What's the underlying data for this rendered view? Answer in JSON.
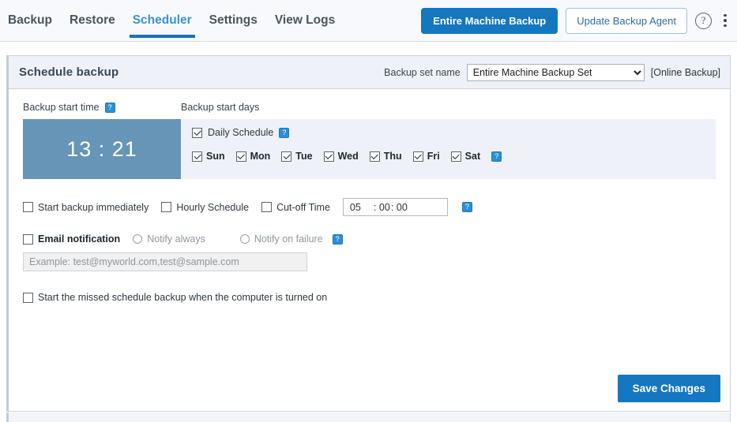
{
  "nav": {
    "items": [
      {
        "label": "Backup",
        "active": false
      },
      {
        "label": "Restore",
        "active": false
      },
      {
        "label": "Scheduler",
        "active": true
      },
      {
        "label": "Settings",
        "active": false
      },
      {
        "label": "View Logs",
        "active": false
      }
    ]
  },
  "top_actions": {
    "primary_button": "Entire Machine Backup",
    "secondary_button": "Update Backup Agent",
    "help_icon": "question-mark-circle-icon",
    "menu_icon": "kebab-menu-icon"
  },
  "panel": {
    "title": "Schedule backup",
    "backup_set_label": "Backup set name",
    "backup_set_value": "Entire Machine Backup Set",
    "backup_set_options": [
      "Entire Machine Backup Set"
    ],
    "online_tag": "[Online Backup]"
  },
  "start_time": {
    "label": "Backup start time",
    "help_icon": "help-icon",
    "value": "13 : 21",
    "hours": "13",
    "minutes": "21"
  },
  "start_days": {
    "label": "Backup start days",
    "daily_schedule": {
      "label": "Daily Schedule",
      "checked": true,
      "help_icon": "help-icon"
    },
    "days": [
      {
        "label": "Sun",
        "checked": true
      },
      {
        "label": "Mon",
        "checked": true
      },
      {
        "label": "Tue",
        "checked": true
      },
      {
        "label": "Wed",
        "checked": true
      },
      {
        "label": "Thu",
        "checked": true
      },
      {
        "label": "Fri",
        "checked": true
      },
      {
        "label": "Sat",
        "checked": true
      }
    ],
    "days_help_icon": "help-icon"
  },
  "options": {
    "start_immediately": {
      "label": "Start backup immediately",
      "checked": false
    },
    "hourly_schedule": {
      "label": "Hourly Schedule",
      "checked": false
    },
    "cutoff_time": {
      "label": "Cut-off Time",
      "checked": false
    },
    "cutoff_value": {
      "hours": "05",
      "minutes": ": 00",
      "seconds": ": 00"
    },
    "cutoff_help_icon": "help-icon"
  },
  "email": {
    "notification": {
      "label": "Email notification",
      "checked": false
    },
    "notify_always": {
      "label": "Notify always",
      "selected": false
    },
    "notify_on_failure": {
      "label": "Notify on failure",
      "selected": false
    },
    "help_icon": "help-icon",
    "input_placeholder": "Example: test@myworld.com,test@sample.com"
  },
  "missed_schedule": {
    "label": "Start the missed schedule backup when the computer is turned on",
    "checked": false
  },
  "footer": {
    "save_button": "Save Changes"
  },
  "colors": {
    "accent_blue": "#1577bf",
    "active_tab": "#3b92d4",
    "time_box": "#6695b8",
    "panel_header": "#eef1f7",
    "help_square": "#2b8fd6"
  }
}
